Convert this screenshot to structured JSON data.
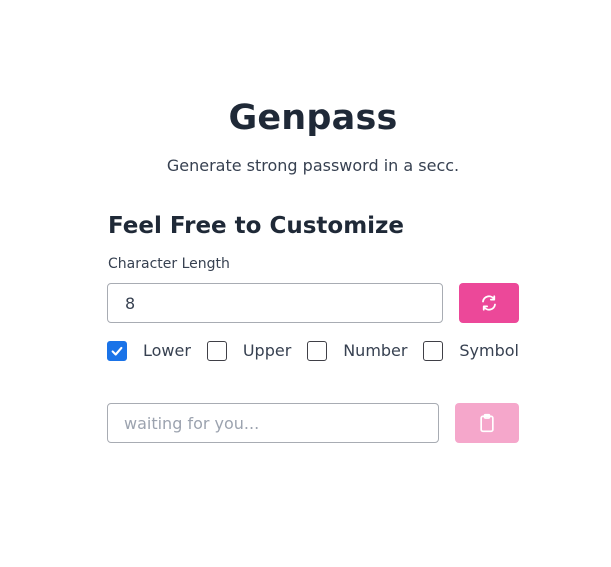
{
  "header": {
    "title": "Genpass",
    "subtitle": "Generate strong password in a secc."
  },
  "customize": {
    "heading": "Feel Free to Customize",
    "length_label": "Character Length",
    "length_value": "8"
  },
  "options": [
    {
      "label": "Lower",
      "checked": true
    },
    {
      "label": "Upper",
      "checked": false
    },
    {
      "label": "Number",
      "checked": false
    },
    {
      "label": "Symbol",
      "checked": false
    }
  ],
  "output": {
    "value": "",
    "placeholder": "waiting for you..."
  },
  "icons": {
    "generate": "refresh-icon",
    "copy": "clipboard-icon"
  },
  "colors": {
    "accent": "#ec4899",
    "accent_disabled": "#f5a7cb",
    "checkbox_checked": "#1a73e8",
    "heading": "#1f2937"
  }
}
